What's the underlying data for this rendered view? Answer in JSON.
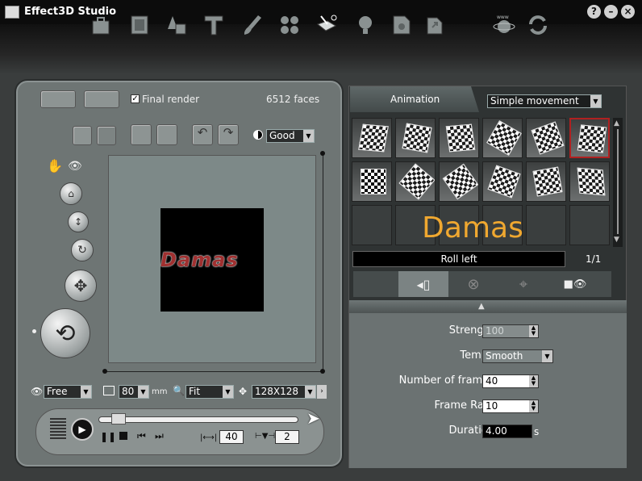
{
  "app": {
    "title": "Effect3D Studio"
  },
  "window_buttons": [
    {
      "name": "help-button",
      "glyph": "?"
    },
    {
      "name": "minimize-button",
      "glyph": "–"
    },
    {
      "name": "close-button",
      "glyph": "×"
    }
  ],
  "toolbar": {
    "tools": [
      "project-icon",
      "frame-icon",
      "shapes-icon",
      "text-icon",
      "paint-icon",
      "arrange-icon",
      "animation-icon",
      "light-icon",
      "settings-icon",
      "export-icon",
      "web-icon",
      "refresh-icon"
    ]
  },
  "render": {
    "final_render_label": "Final render",
    "final_render_checked": true,
    "faces": "6512 faces"
  },
  "quality": {
    "value": "Good"
  },
  "preview": {
    "text": "Damas"
  },
  "bottom_controls": {
    "view_mode": "Free",
    "focal": "80",
    "focal_unit": "mm",
    "zoom": "Fit",
    "size": "128X128"
  },
  "timeline": {
    "frames_field": "40",
    "step_field": "2"
  },
  "animation": {
    "tab_label": "Animation",
    "type": "Simple movement",
    "preset_title": "Damas",
    "selected_name": "Roll left",
    "page": "1/1"
  },
  "params": {
    "strength_label": "Strength",
    "strength_value": "100",
    "tempo_label": "Tempo",
    "tempo_value": "Smooth",
    "frames_label": "Number of frames",
    "frames_value": "40",
    "rate_label": "Frame Rate",
    "rate_value": "10",
    "duration_label": "Duration",
    "duration_value": "4.00",
    "duration_unit": "s"
  },
  "colors": {
    "accent": "#f0a830",
    "selection": "#b02020"
  }
}
